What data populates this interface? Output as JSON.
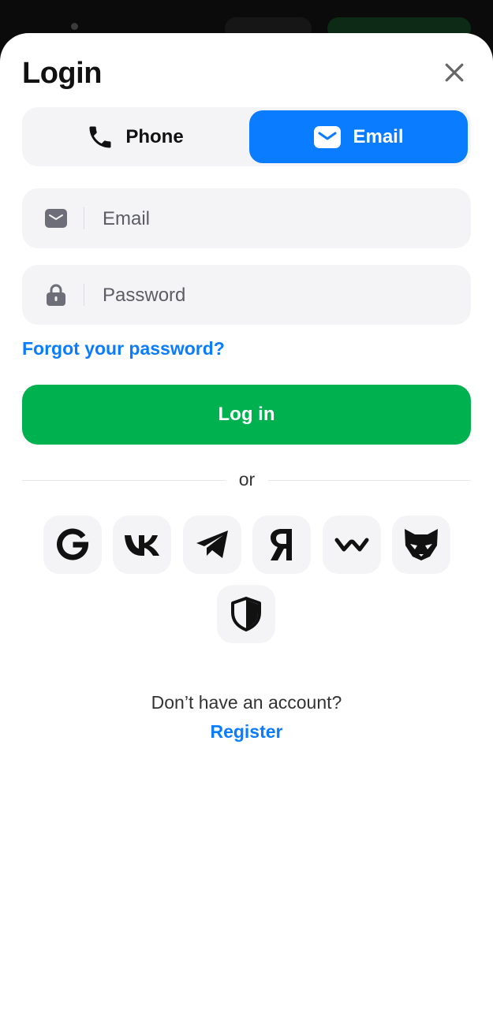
{
  "header": {
    "title": "Login"
  },
  "tabs": [
    {
      "label": "Phone",
      "icon": "phone-icon",
      "active": false
    },
    {
      "label": "Email",
      "icon": "mail-icon",
      "active": true
    }
  ],
  "fields": {
    "email": {
      "placeholder": "Email",
      "value": "",
      "icon": "mail-icon"
    },
    "password": {
      "placeholder": "Password",
      "value": "",
      "icon": "lock-icon"
    }
  },
  "links": {
    "forgot": "Forgot your password?",
    "register": "Register"
  },
  "buttons": {
    "login": "Log in"
  },
  "divider": {
    "label": "or"
  },
  "social": [
    "google-icon",
    "vk-icon",
    "telegram-icon",
    "yandex-icon",
    "walletconnect-icon",
    "fox-icon",
    "shield-icon"
  ],
  "footer": {
    "no_account": "Don’t have an account?"
  },
  "colors": {
    "accent": "#0a7cff",
    "login_button": "#00b14f",
    "field_bg": "#f4f4f6"
  }
}
